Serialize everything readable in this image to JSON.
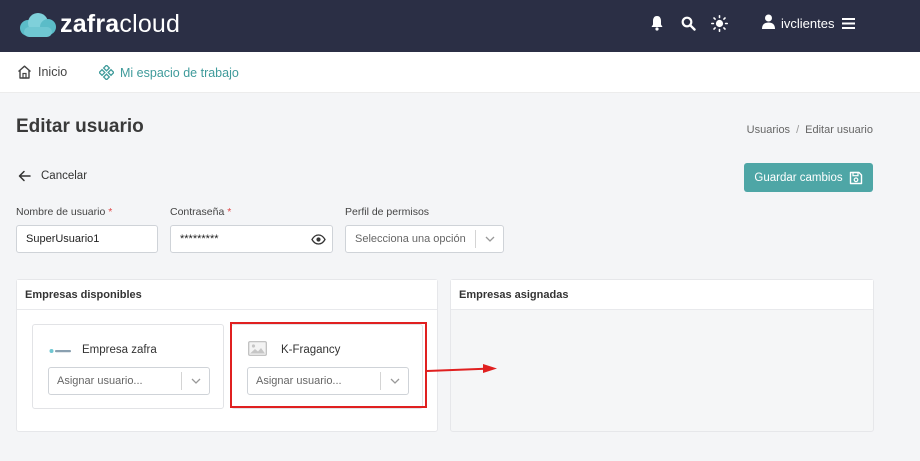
{
  "header": {
    "logo_bold": "zafra",
    "logo_light": "cloud",
    "user_name": "ivclientes",
    "icons": [
      "bell-icon",
      "search-icon",
      "sun-icon",
      "user-icon",
      "menu-icon"
    ]
  },
  "nav": {
    "home": "Inicio",
    "workspace": "Mi espacio de trabajo"
  },
  "page": {
    "title": "Editar usuario",
    "breadcrumb": [
      "Usuarios",
      "Editar usuario"
    ],
    "cancel": "Cancelar",
    "save": "Guardar cambios"
  },
  "form": {
    "username_label": "Nombre de usuario",
    "username_value": "SuperUsuario1",
    "password_label": "Contraseña",
    "password_value": "*********",
    "perfil_label": "Perfil de permisos",
    "perfil_placeholder": "Selecciona una opción",
    "required_mark": "*"
  },
  "companies": {
    "available_title": "Empresas disponibles",
    "assigned_title": "Empresas asignadas",
    "items": [
      {
        "name": "Empresa zafra",
        "select_placeholder": "Asignar usuario..."
      },
      {
        "name": "K-Fragancy",
        "select_placeholder": "Asignar usuario..."
      }
    ]
  },
  "colors": {
    "topbar": "#2b2f45",
    "accent": "#4ea6a6",
    "highlight": "#e02020"
  }
}
